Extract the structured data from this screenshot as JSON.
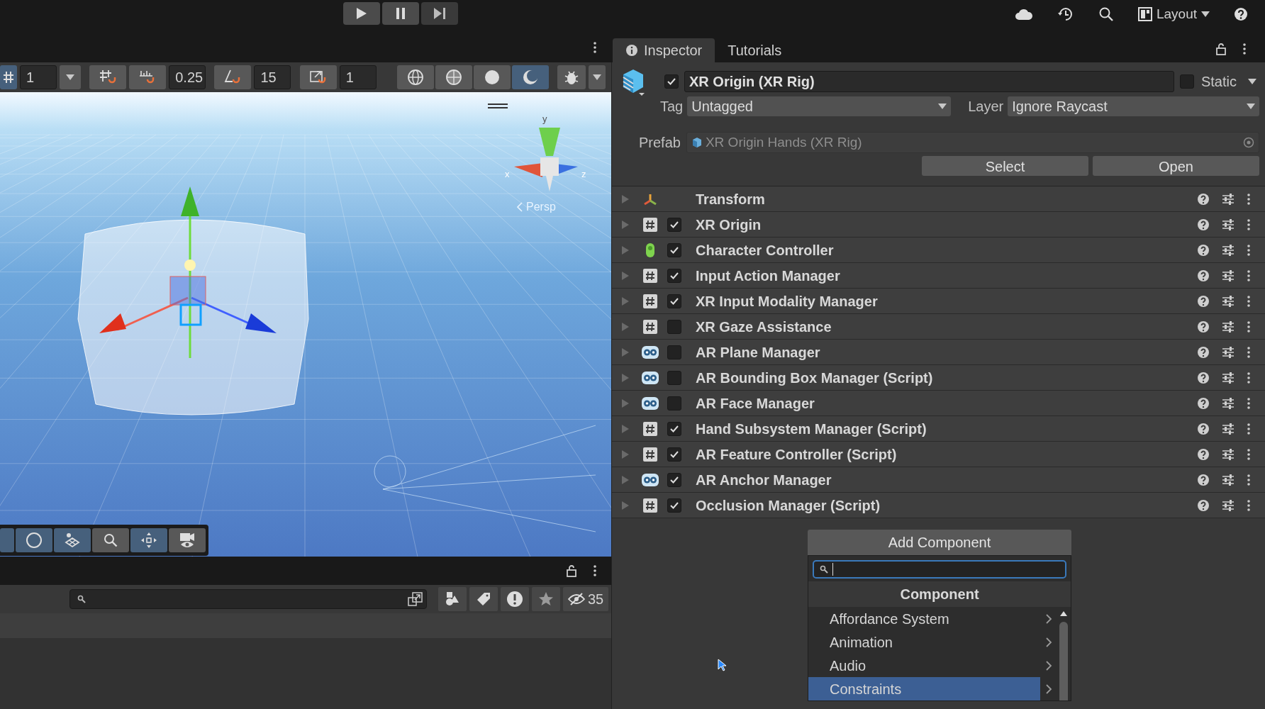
{
  "top_bar": {
    "layout": "Layout"
  },
  "scene_toolbar": {
    "grid_toggle": {
      "selected": true
    },
    "grid_size": "1",
    "move_snap_value": "0.25",
    "rotate_snap_value": "15",
    "scale_snap_value": "1",
    "shading_modes": [
      {
        "selected": false
      },
      {
        "selected": false
      },
      {
        "selected": false
      },
      {
        "selected": true
      }
    ]
  },
  "scene_view": {
    "gizmo_labels": [
      "y",
      "x",
      "z"
    ],
    "projection": "Persp"
  },
  "overlay_toolbar": [
    {
      "selected": true
    },
    {
      "selected": true
    },
    {
      "selected": true
    },
    {
      "selected": false
    },
    {
      "selected": true
    },
    {
      "selected": false
    }
  ],
  "hierarchy_panel": {
    "hidden_count": "35"
  },
  "inspector": {
    "tabs": [
      {
        "label": "Inspector",
        "selected": true
      },
      {
        "label": "Tutorials",
        "selected": false
      }
    ],
    "object": {
      "active": true,
      "name": "XR Origin (XR Rig)",
      "static": false,
      "static_label": "Static"
    },
    "tag": {
      "label": "Tag",
      "value": "Untagged"
    },
    "layer": {
      "label": "Layer",
      "value": "Ignore Raycast"
    },
    "prefab": {
      "label": "Prefab",
      "value": "XR Origin Hands (XR Rig)"
    },
    "prefab_buttons": [
      "Select",
      "Open"
    ],
    "components": [
      {
        "kind": "transform",
        "name": "Transform"
      },
      {
        "kind": "script",
        "name": "XR Origin",
        "checked": true
      },
      {
        "kind": "character_controller",
        "name": "Character Controller",
        "checked": true
      },
      {
        "kind": "script",
        "name": "Input Action Manager",
        "checked": true
      },
      {
        "kind": "script",
        "name": "XR Input Modality Manager",
        "checked": true
      },
      {
        "kind": "script",
        "name": "XR Gaze Assistance",
        "checked": false
      },
      {
        "kind": "ar",
        "name": "AR Plane Manager",
        "checked": false
      },
      {
        "kind": "ar",
        "name": "AR Bounding Box Manager (Script)",
        "checked": false
      },
      {
        "kind": "ar",
        "name": "AR Face Manager",
        "checked": false
      },
      {
        "kind": "script",
        "name": "Hand Subsystem Manager (Script)",
        "checked": true
      },
      {
        "kind": "script",
        "name": "AR Feature Controller (Script)",
        "checked": true
      },
      {
        "kind": "ar",
        "name": "AR Anchor Manager",
        "checked": true
      },
      {
        "kind": "script",
        "name": "Occlusion Manager (Script)",
        "checked": true
      }
    ],
    "add_component": {
      "label": "Add Component",
      "header": "Component",
      "items": [
        {
          "label": "Affordance System",
          "selected": false
        },
        {
          "label": "Animation",
          "selected": false
        },
        {
          "label": "Audio",
          "selected": false
        },
        {
          "label": "Constraints",
          "selected": true
        }
      ]
    }
  }
}
